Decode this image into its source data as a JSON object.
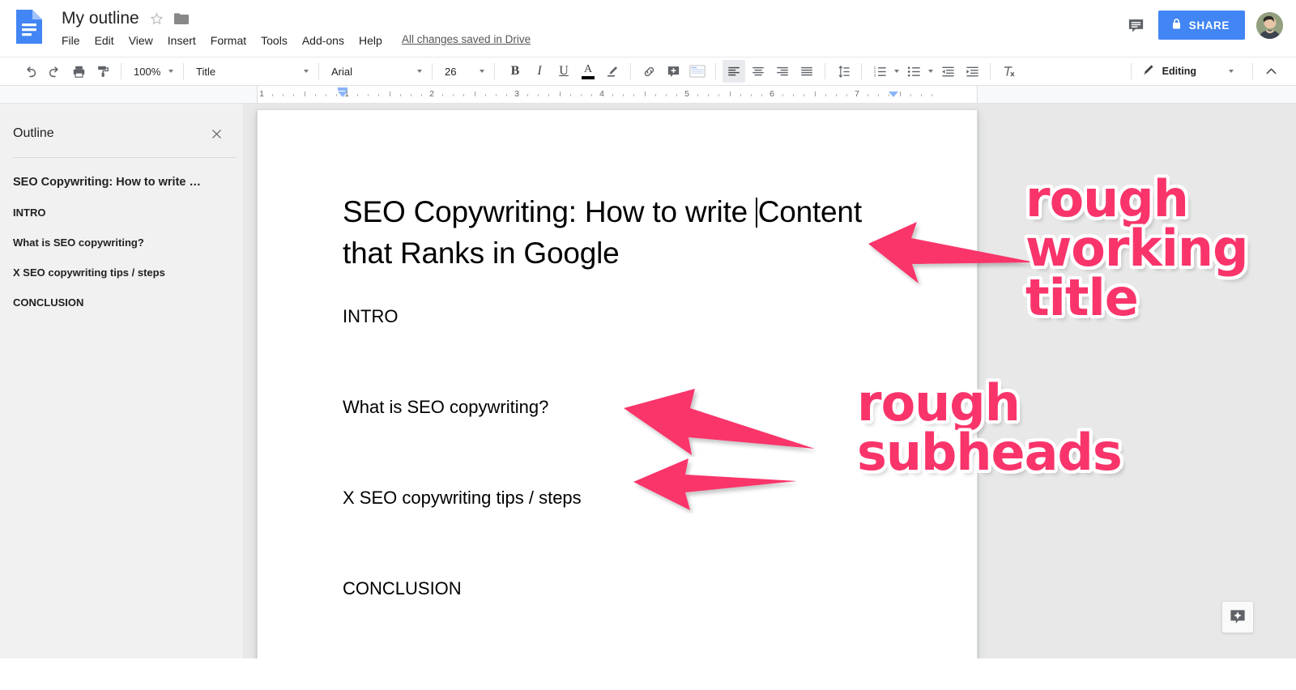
{
  "app": {
    "name": "Google Docs",
    "doc_icon": "google-docs-icon"
  },
  "header": {
    "doc_title": "My outline",
    "star_icon": "star-outline-icon",
    "folder_icon": "move-to-folder-icon",
    "menus": [
      "File",
      "Edit",
      "View",
      "Insert",
      "Format",
      "Tools",
      "Add-ons",
      "Help"
    ],
    "save_status": "All changes saved in Drive",
    "comment_icon": "comment-history-icon",
    "share_label": "SHARE",
    "share_lock_icon": "lock-icon",
    "share_color": "#4285f4",
    "avatar": "user-avatar"
  },
  "toolbar": {
    "undo_icon": "undo-icon",
    "redo_icon": "redo-icon",
    "print_icon": "print-icon",
    "paint_format_icon": "paint-format-icon",
    "zoom": "100%",
    "paragraph_style": "Title",
    "font": "Arial",
    "font_size": "26",
    "bold": "B",
    "italic": "I",
    "underline": "U",
    "text_color_icon": "text-color-icon",
    "highlight_icon": "highlight-color-icon",
    "link_icon": "insert-link-icon",
    "comment_icon": "add-comment-icon",
    "image_icon": "insert-image-icon",
    "align_left_icon": "align-left-icon",
    "align_center_icon": "align-center-icon",
    "align_right_icon": "align-right-icon",
    "align_justify_icon": "align-justify-icon",
    "line_spacing_icon": "line-spacing-icon",
    "numbered_list_icon": "numbered-list-icon",
    "bulleted_list_icon": "bulleted-list-icon",
    "decrease_indent_icon": "decrease-indent-icon",
    "increase_indent_icon": "increase-indent-icon",
    "clear_formatting_icon": "clear-formatting-icon",
    "mode_label": "Editing",
    "mode_icon": "pencil-icon",
    "collapse_icon": "chevron-up-icon"
  },
  "ruler": {
    "numbers": [
      "1",
      "1",
      "2",
      "3",
      "4",
      "5",
      "6",
      "7"
    ],
    "left_indent_marker": "left-indent-marker",
    "right_indent_marker": "right-indent-marker"
  },
  "outline": {
    "title": "Outline",
    "close_icon": "close-icon",
    "items": [
      {
        "label": "SEO Copywriting: How to write …",
        "level": "title"
      },
      {
        "label": "INTRO",
        "level": "heading"
      },
      {
        "label": "What is SEO copywriting?",
        "level": "heading"
      },
      {
        "label": "X SEO copywriting tips / steps",
        "level": "heading"
      },
      {
        "label": "CONCLUSION",
        "level": "heading"
      }
    ]
  },
  "document": {
    "title_part1": "SEO Copywriting: How to write ",
    "title_part2": "Content that Ranks in Google",
    "paragraphs": [
      "INTRO",
      "What is SEO copywriting?",
      "X SEO copywriting tips / steps",
      "CONCLUSION"
    ]
  },
  "explore": {
    "icon": "explore-sparkle-icon"
  },
  "annotations": {
    "color": "#f9346b",
    "outline_color": "#ffffff",
    "title_note": "rough\nworking\ntitle",
    "title_note_lines": [
      "rough",
      "working",
      "title"
    ],
    "subhead_note": "rough\nsubheads",
    "subhead_note_lines": [
      "rough",
      "subheads"
    ],
    "arrows": [
      {
        "name": "arrow-to-title",
        "points_to": "document title"
      },
      {
        "name": "arrow-to-subhead-1",
        "points_to": "What is SEO copywriting?"
      },
      {
        "name": "arrow-to-subhead-2",
        "points_to": "X SEO copywriting tips / steps"
      }
    ]
  }
}
